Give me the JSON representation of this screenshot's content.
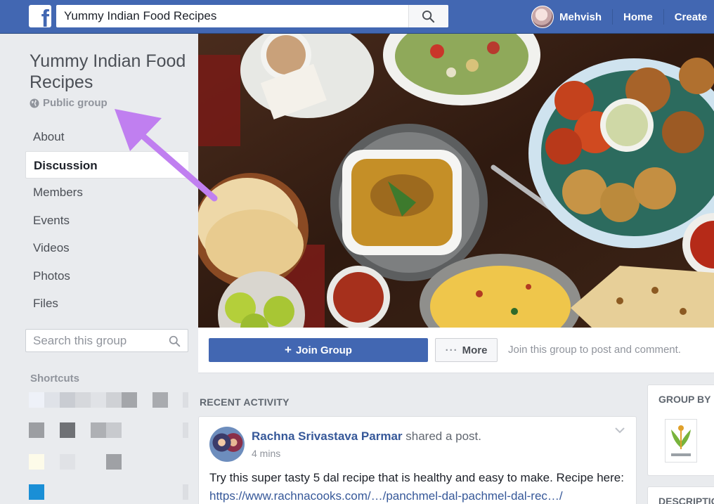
{
  "topbar": {
    "logo": "f",
    "search_value": "Yummy Indian Food Recipes",
    "search_icon": "search-icon",
    "user_name": "Mehvish",
    "home_label": "Home",
    "create_label": "Create"
  },
  "group": {
    "title": "Yummy Indian Food Recipes",
    "privacy": "Public group",
    "privacy_icon": "globe-icon"
  },
  "sidebar": {
    "items": [
      {
        "label": "About"
      },
      {
        "label": "Discussion"
      },
      {
        "label": "Members"
      },
      {
        "label": "Events"
      },
      {
        "label": "Videos"
      },
      {
        "label": "Photos"
      },
      {
        "label": "Files"
      }
    ],
    "active_index": 1,
    "search_placeholder": "Search this group",
    "shortcuts_title": "Shortcuts"
  },
  "actions": {
    "join_label": "Join Group",
    "join_icon": "+",
    "more_label": "More",
    "more_icon": "···",
    "hint": "Join this group to post and comment."
  },
  "feed": {
    "section_title": "RECENT ACTIVITY",
    "post": {
      "author": "Rachna Srivastava Parmar",
      "action": "shared a post.",
      "time": "4 mins",
      "text": "Try this super tasty 5 dal recipe that is healthy and easy to make. Recipe here:",
      "link": "https://www.rachnacooks.com/…/panchmel-dal-pachmel-dal-rec…/"
    }
  },
  "right_rail": {
    "group_by_label": "GROUP BY",
    "description_label": "DESCRIPTION"
  },
  "colors": {
    "brand": "#4267b2",
    "link": "#365899",
    "annotation_arrow": "#c07ff0"
  }
}
